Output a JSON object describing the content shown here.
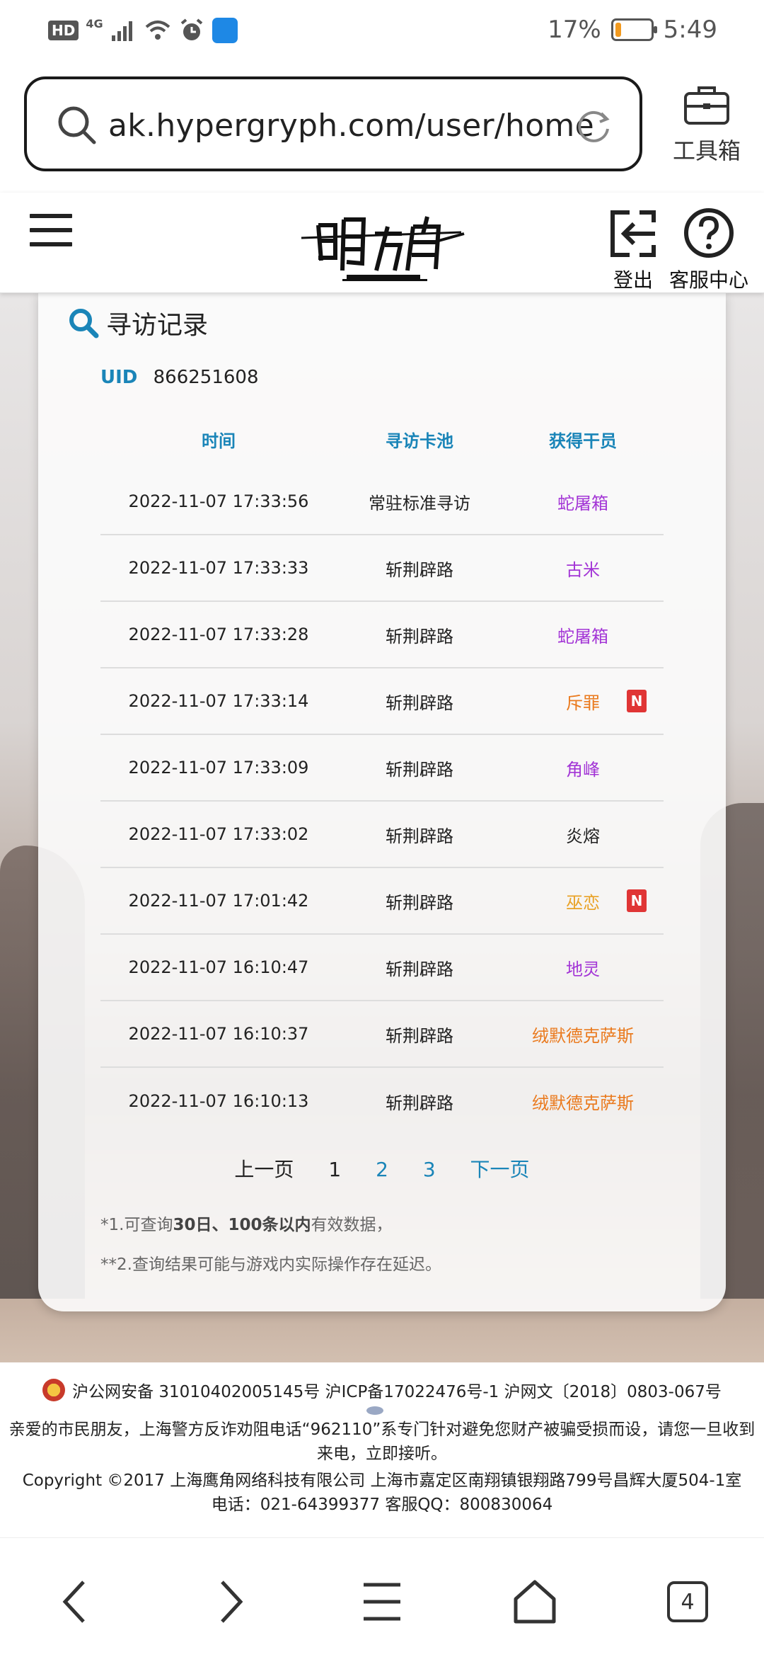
{
  "status_bar": {
    "hd": "HD",
    "network": "4G",
    "battery_text": "17%",
    "battery_level": 0.17,
    "time": "5:49"
  },
  "browser": {
    "url": "ak.hypergryph.com/user/home",
    "toolbox_label": "工具箱"
  },
  "site_header": {
    "logout_label": "登出",
    "help_label": "客服中心"
  },
  "card": {
    "title": "寻访记录",
    "uid_label": "UID",
    "uid_value": "866251608",
    "columns": [
      "时间",
      "寻访卡池",
      "获得干员"
    ],
    "rows": [
      {
        "time": "2022-11-07 17:33:56",
        "pool": "常驻标准寻访",
        "operator": "蛇屠箱",
        "color": "#a335d6",
        "new": false
      },
      {
        "time": "2022-11-07 17:33:33",
        "pool": "斩荆辟路",
        "operator": "古米",
        "color": "#a335d6",
        "new": false
      },
      {
        "time": "2022-11-07 17:33:28",
        "pool": "斩荆辟路",
        "operator": "蛇屠箱",
        "color": "#a335d6",
        "new": false
      },
      {
        "time": "2022-11-07 17:33:14",
        "pool": "斩荆辟路",
        "operator": "斥罪",
        "color": "#ea7a1e",
        "new": true,
        "badge": "N"
      },
      {
        "time": "2022-11-07 17:33:09",
        "pool": "斩荆辟路",
        "operator": "角峰",
        "color": "#a335d6",
        "new": false
      },
      {
        "time": "2022-11-07 17:33:02",
        "pool": "斩荆辟路",
        "operator": "炎熔",
        "color": "#222222",
        "new": false
      },
      {
        "time": "2022-11-07 17:01:42",
        "pool": "斩荆辟路",
        "operator": "巫恋",
        "color": "#e9a227",
        "new": true,
        "badge": "N"
      },
      {
        "time": "2022-11-07 16:10:47",
        "pool": "斩荆辟路",
        "operator": "地灵",
        "color": "#a335d6",
        "new": false
      },
      {
        "time": "2022-11-07 16:10:37",
        "pool": "斩荆辟路",
        "operator": "绒默德克萨斯",
        "color": "#ea7a1e",
        "new": false
      },
      {
        "time": "2022-11-07 16:10:13",
        "pool": "斩荆辟路",
        "operator": "绒默德克萨斯",
        "color": "#ea7a1e",
        "new": false
      }
    ],
    "pager": {
      "prev": "上一页",
      "current": "1",
      "page2": "2",
      "page3": "3",
      "next": "下一页"
    },
    "note1": {
      "pre": "*1.可查询",
      "bold": "30日、100条以内",
      "post": "有效数据，"
    },
    "note2": "**2.查询结果可能与游戏内实际操作存在延迟。"
  },
  "footer": {
    "line1": "沪公网安备 31010402005145号  沪ICP备17022476号-1  沪网文〔2018〕0803-067号",
    "line2": "亲爱的市民朋友，上海警方反诈劝阻电话“962110”系专门针对避免您财产被骗受损而设，请您一旦收到来电，立即接听。",
    "line3": "Copyright ©2017 上海鹰角网络科技有限公司  上海市嘉定区南翔镇银翔路799号昌辉大厦504-1室",
    "line4": "电话：021-64399377 客服QQ：800830064"
  },
  "nav": {
    "tabs_count": "4"
  },
  "colors": {
    "accent": "#1a85b8",
    "rare_purple": "#a335d6",
    "rare_orange": "#ea7a1e",
    "new_badge": "#e03535"
  }
}
